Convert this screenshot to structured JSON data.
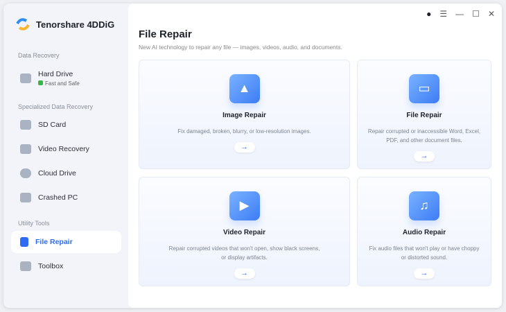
{
  "app": {
    "title": "Tenorshare 4DDiG"
  },
  "sidebar": {
    "sections": [
      "Data Recovery",
      "Specialized Data Recovery",
      "Utility Tools"
    ],
    "hard_drive": {
      "label": "Hard Drive",
      "badge": "Fast and Safe"
    },
    "items": [
      {
        "label": "SD Card"
      },
      {
        "label": "Video Recovery"
      },
      {
        "label": "Cloud Drive"
      },
      {
        "label": "Crashed PC"
      },
      {
        "label": "File Repair"
      },
      {
        "label": "Toolbox"
      }
    ]
  },
  "main": {
    "title": "File Repair",
    "subtitle": "New AI technology to repair any file — images, videos, audio, and documents.",
    "cards": [
      {
        "title": "Image Repair",
        "desc": "Fix damaged, broken, blurry, or low-resolution images.",
        "icon": "▲"
      },
      {
        "title": "File Repair",
        "desc": "Repair corrupted or inaccessible Word, Excel, PDF, and other document files.",
        "icon": "▭"
      },
      {
        "title": "Video Repair",
        "desc": "Repair corrupted videos that won't open, show black screens, or display artifacts.",
        "icon": "▶"
      },
      {
        "title": "Audio Repair",
        "desc": "Fix audio files that won't play or have choppy or distorted sound.",
        "icon": "♫"
      }
    ],
    "arrow": "→"
  },
  "window_controls": {
    "assistant": "●",
    "menu": "☰",
    "minimize": "—",
    "maximize": "☐",
    "close": "✕"
  },
  "colors": {
    "accent": "#2d6cf0",
    "sidebar_bg": "#f2f4fa"
  }
}
